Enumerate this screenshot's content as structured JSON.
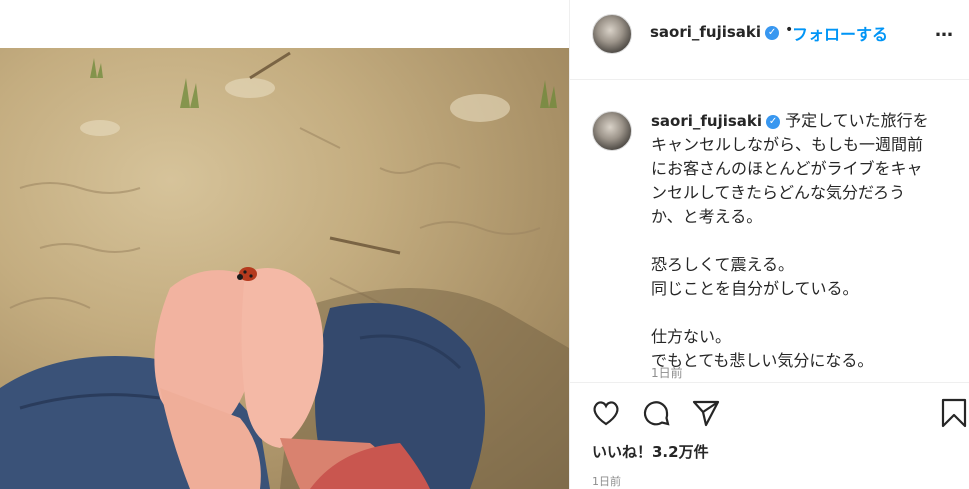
{
  "post": {
    "image_alt": "child's hands holding a ladybug over dirt ground"
  },
  "header": {
    "username": "saori_fujisaki",
    "verified_icon": "verified-badge-icon",
    "separator": "•",
    "follow_label": "フォローする",
    "more_label": "…"
  },
  "caption": {
    "username": "saori_fujisaki",
    "text": " 予定していた旅行を\nキャンセルしながら、もしも一週間前\nにお客さんのほとんどがライブをキャ\nンセルしてきたらどんな気分だろう\nか、と考える。\n\n恐ろしくて震える。\n同じことを自分がしている。\n\n仕方ない。\nでもとても悲しい気分になる。",
    "time": "1日前"
  },
  "actions": {
    "like_icon": "heart-icon",
    "comment_icon": "comment-icon",
    "share_icon": "share-icon",
    "save_icon": "bookmark-icon",
    "likes_text": "いいね！3.2万件",
    "time": "1日前"
  },
  "colors": {
    "accent": "#0095f6",
    "verified": "#3897f0",
    "muted": "#8e8e8e",
    "border": "#efefef"
  }
}
